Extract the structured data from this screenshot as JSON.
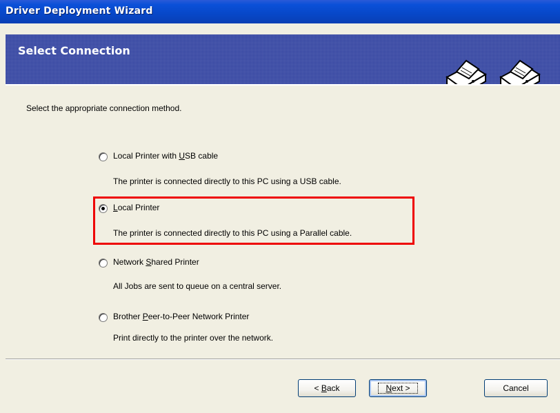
{
  "window": {
    "title": "Driver Deployment Wizard"
  },
  "banner": {
    "title": "Select Connection",
    "icon": "printer-icon"
  },
  "content": {
    "instruction": "Select the appropriate connection method.",
    "options": [
      {
        "label_pre": "Local Printer with ",
        "label_accel": "U",
        "label_post": "SB cable",
        "description": "The printer is connected directly to this PC using a USB cable.",
        "checked": false
      },
      {
        "label_pre": "",
        "label_accel": "L",
        "label_post": "ocal Printer",
        "description": "The printer is connected directly to this PC using a Parallel cable.",
        "checked": true
      },
      {
        "label_pre": "Network ",
        "label_accel": "S",
        "label_post": "hared Printer",
        "description": "All Jobs are sent to queue on a central server.",
        "checked": false
      },
      {
        "label_pre": "Brother ",
        "label_accel": "P",
        "label_post": "eer-to-Peer Network Printer",
        "description": "Print directly to the printer over the network.",
        "checked": false
      }
    ]
  },
  "buttons": {
    "back": {
      "prefix": "< ",
      "accel": "B",
      "suffix": "ack"
    },
    "next": {
      "prefix": "",
      "accel": "N",
      "suffix": "ext >"
    },
    "cancel": "Cancel"
  },
  "colors": {
    "highlight": "#e00000",
    "banner": "#2e3f9e",
    "titlebar": "#0747c8"
  }
}
